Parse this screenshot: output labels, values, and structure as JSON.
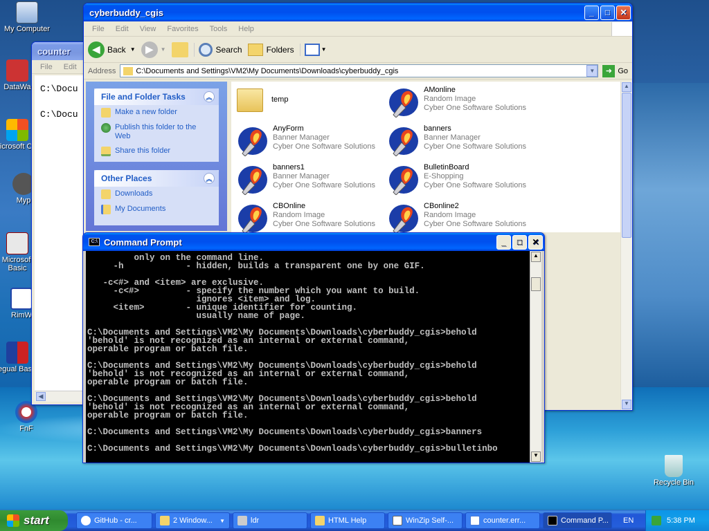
{
  "desktop": {
    "icons": [
      {
        "label": "My Computer"
      },
      {
        "label": "DataWa"
      },
      {
        "label": "Microsoft C++"
      },
      {
        "label": "Myp"
      },
      {
        "label": "Microsoft Basic"
      },
      {
        "label": "RimW"
      },
      {
        "label": "Regual Basket"
      },
      {
        "label": "FnF"
      },
      {
        "label": "Recycle Bin"
      }
    ]
  },
  "counter_window": {
    "title": "counter",
    "menu": [
      "File",
      "Edit",
      "F"
    ],
    "lines": [
      "C:\\Docu",
      "C:\\Docu"
    ]
  },
  "explorer": {
    "title": "cyberbuddy_cgis",
    "menu": [
      "File",
      "Edit",
      "View",
      "Favorites",
      "Tools",
      "Help"
    ],
    "toolbar": {
      "back": "Back",
      "search": "Search",
      "folders": "Folders"
    },
    "address_label": "Address",
    "address_value": "C:\\Documents and Settings\\VM2\\My Documents\\Downloads\\cyberbuddy_cgis",
    "go": "Go",
    "tasks_title": "File and Folder Tasks",
    "tasks": [
      "Make a new folder",
      "Publish this folder to the Web",
      "Share this folder"
    ],
    "places_title": "Other Places",
    "places": [
      "Downloads",
      "My Documents"
    ],
    "files": [
      {
        "name": "temp",
        "type": "",
        "company": ""
      },
      {
        "name": "AMonline",
        "type": "Random Image",
        "company": "Cyber One Software Solutions"
      },
      {
        "name": "AnyForm",
        "type": "Banner Manager",
        "company": "Cyber One Software Solutions"
      },
      {
        "name": "banners",
        "type": "Banner Manager",
        "company": "Cyber One Software Solutions"
      },
      {
        "name": "banners1",
        "type": "Banner Manager",
        "company": "Cyber One Software Solutions"
      },
      {
        "name": "BulletinBoard",
        "type": "E-Shopping",
        "company": "Cyber One Software Solutions"
      },
      {
        "name": "CBOnline",
        "type": "Random Image",
        "company": "Cyber One Software Solutions"
      },
      {
        "name": "CBonline2",
        "type": "Random Image",
        "company": "Cyber One Software Solutions"
      }
    ]
  },
  "cmd": {
    "title": "Command Prompt",
    "text": "         only on the command line.\n     -h            - hidden, builds a transparent one by one GIF.\n\n   -c<#> and <item> are exclusive.\n     -c<#>         - specify the number which you want to build.\n                     ignores <item> and log.\n     <item>        - unique identifier for counting.\n                     usually name of page.\n\nC:\\Documents and Settings\\VM2\\My Documents\\Downloads\\cyberbuddy_cgis>behold\n'behold' is not recognized as an internal or external command,\noperable program or batch file.\n\nC:\\Documents and Settings\\VM2\\My Documents\\Downloads\\cyberbuddy_cgis>behold\n'behold' is not recognized as an internal or external command,\noperable program or batch file.\n\nC:\\Documents and Settings\\VM2\\My Documents\\Downloads\\cyberbuddy_cgis>behold\n'behold' is not recognized as an internal or external command,\noperable program or batch file.\n\nC:\\Documents and Settings\\VM2\\My Documents\\Downloads\\cyberbuddy_cgis>banners\n\nC:\\Documents and Settings\\VM2\\My Documents\\Downloads\\cyberbuddy_cgis>bulletinbo"
  },
  "taskbar": {
    "start": "start",
    "tasks": [
      "GitHub - cr...",
      "2 Window...",
      "ldr",
      "HTML Help",
      "WinZip Self-...",
      "counter.err...",
      "Command P..."
    ],
    "lang": "EN",
    "clock": "5:38 PM"
  }
}
